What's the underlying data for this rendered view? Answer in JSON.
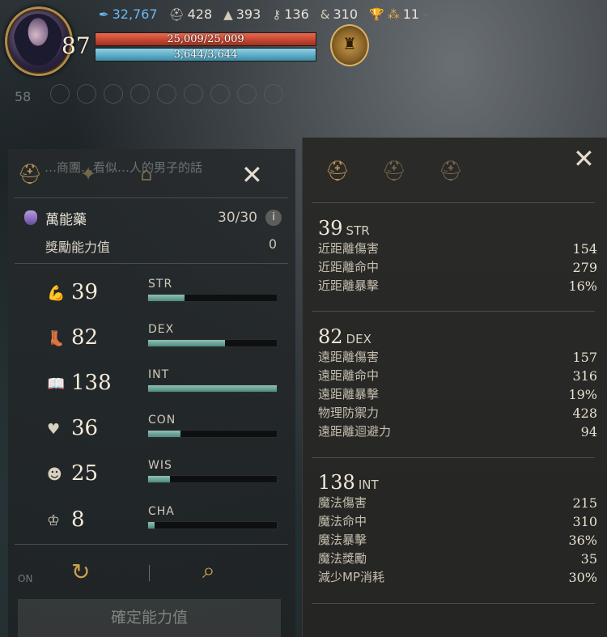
{
  "hud": {
    "level": "87",
    "resources": [
      {
        "icon": "feather-icon",
        "value": "32,767",
        "color": "#6ab8f2"
      },
      {
        "icon": "helmet-icon",
        "value": "428"
      },
      {
        "icon": "wizard-hat-icon",
        "value": "393"
      },
      {
        "icon": "wand-icon",
        "value": "136"
      },
      {
        "icon": "ampersand-icon",
        "value": "310"
      },
      {
        "icon": "trophy-icon",
        "value": ""
      },
      {
        "icon": "triangle-rank-icon",
        "value": "11",
        "color": "#e0a94b"
      }
    ],
    "hp": "25,009/25,009",
    "mp": "3,644/3,644",
    "hint_level": "58",
    "ghost_text": "…商團…看似…人的男子的話"
  },
  "left": {
    "elixir_label": "萬能藥",
    "elixir_count": "30/30",
    "info": "i",
    "bonus_label": "獎勵能力值",
    "bonus_value": "0",
    "on_label": "ON",
    "confirm_label": "確定能力值",
    "attributes": [
      {
        "icon": "muscle-icon",
        "value": "39",
        "name": "STR",
        "fill": 0.28
      },
      {
        "icon": "boot-icon",
        "value": "82",
        "name": "DEX",
        "fill": 0.6
      },
      {
        "icon": "book-icon",
        "value": "138",
        "name": "INT",
        "fill": 1.0
      },
      {
        "icon": "heart-icon",
        "value": "36",
        "name": "CON",
        "fill": 0.25
      },
      {
        "icon": "head-icon",
        "value": "25",
        "name": "WIS",
        "fill": 0.17
      },
      {
        "icon": "crown-icon",
        "value": "8",
        "name": "CHA",
        "fill": 0.05
      }
    ]
  },
  "right": {
    "sections": [
      {
        "value": "39",
        "name": "STR",
        "rows": [
          {
            "label": "近距離傷害",
            "value": "154"
          },
          {
            "label": "近距離命中",
            "value": "279"
          },
          {
            "label": "近距離暴擊",
            "value": "16%"
          }
        ]
      },
      {
        "value": "82",
        "name": "DEX",
        "rows": [
          {
            "label": "遠距離傷害",
            "value": "157"
          },
          {
            "label": "遠距離命中",
            "value": "316"
          },
          {
            "label": "遠距離暴擊",
            "value": "19%"
          },
          {
            "label": "物理防禦力",
            "value": "428"
          },
          {
            "label": "遠距離迴避力",
            "value": "94"
          }
        ]
      },
      {
        "value": "138",
        "name": "INT",
        "rows": [
          {
            "label": "魔法傷害",
            "value": "215"
          },
          {
            "label": "魔法命中",
            "value": "310"
          },
          {
            "label": "魔法暴擊",
            "value": "36%"
          },
          {
            "label": "魔法獎勵",
            "value": "35"
          },
          {
            "label": "減少MP消耗",
            "value": "30%"
          }
        ]
      }
    ]
  }
}
